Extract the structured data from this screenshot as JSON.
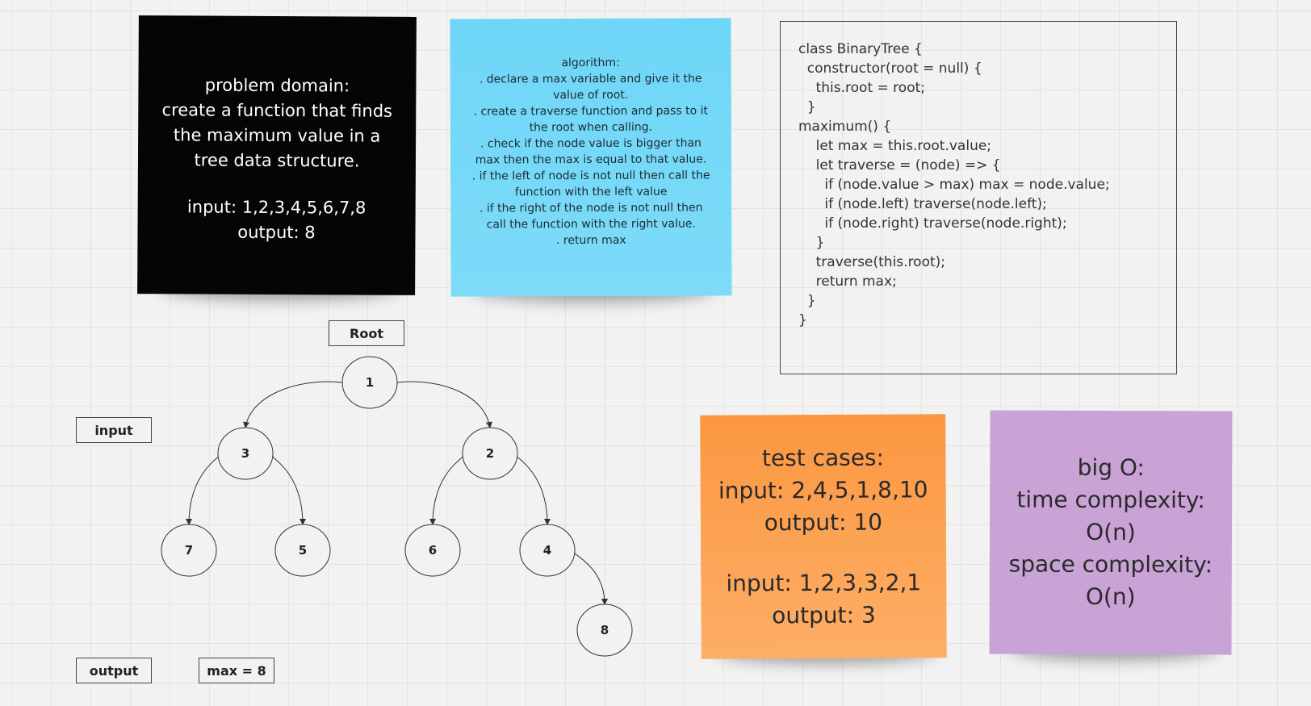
{
  "problem_note": {
    "lines": [
      "problem domain:",
      "create a function that finds",
      "the maximum value in a",
      "tree data structure.",
      "",
      "input: 1,2,3,4,5,6,7,8",
      "output: 8"
    ],
    "color": "#050505"
  },
  "algorithm_note": {
    "lines": [
      "algorithm:",
      ". declare a max variable and give it the",
      "value of root.",
      ". create a traverse function and pass to it",
      "the root when calling.",
      ". check if the node value is bigger than",
      "max then the max is equal to that value.",
      ". if the left of node is not null then call the",
      "function with the left value",
      ". if the right of the node is not null then",
      "call the function with the right value.",
      ". return max"
    ],
    "color": "#76d8f8"
  },
  "code_box": {
    "lines": [
      "class BinaryTree {",
      "  constructor(root = null) {",
      "    this.root = root;",
      "  }",
      "maximum() {",
      "    let max = this.root.value;",
      "    let traverse = (node) => {",
      "      if (node.value > max) max = node.value;",
      "      if (node.left) traverse(node.left);",
      "      if (node.right) traverse(node.right);",
      "    }",
      "    traverse(this.root);",
      "    return max;",
      "  }",
      "}"
    ]
  },
  "test_note": {
    "lines": [
      "test cases:",
      "input: 2,4,5,1,8,10",
      "output: 10",
      "",
      "input: 1,2,3,3,2,1",
      "output: 3"
    ],
    "color": "#fca055"
  },
  "bigo_note": {
    "lines": [
      "big O:",
      "time complexity:",
      "O(n)",
      "space complexity:",
      "O(n)"
    ],
    "color": "#c9a2d6"
  },
  "labels": {
    "root": "Root",
    "input": "input",
    "output": "output",
    "result": "max = 8"
  },
  "tree": {
    "nodes": [
      {
        "id": "n1",
        "value": "1"
      },
      {
        "id": "n3",
        "value": "3"
      },
      {
        "id": "n2",
        "value": "2"
      },
      {
        "id": "n7",
        "value": "7"
      },
      {
        "id": "n5",
        "value": "5"
      },
      {
        "id": "n6",
        "value": "6"
      },
      {
        "id": "n4",
        "value": "4"
      },
      {
        "id": "n8",
        "value": "8"
      }
    ],
    "edges": [
      {
        "from": "n1",
        "to": "n3"
      },
      {
        "from": "n1",
        "to": "n2"
      },
      {
        "from": "n3",
        "to": "n7"
      },
      {
        "from": "n3",
        "to": "n5"
      },
      {
        "from": "n2",
        "to": "n6"
      },
      {
        "from": "n2",
        "to": "n4"
      },
      {
        "from": "n4",
        "to": "n8"
      }
    ]
  }
}
